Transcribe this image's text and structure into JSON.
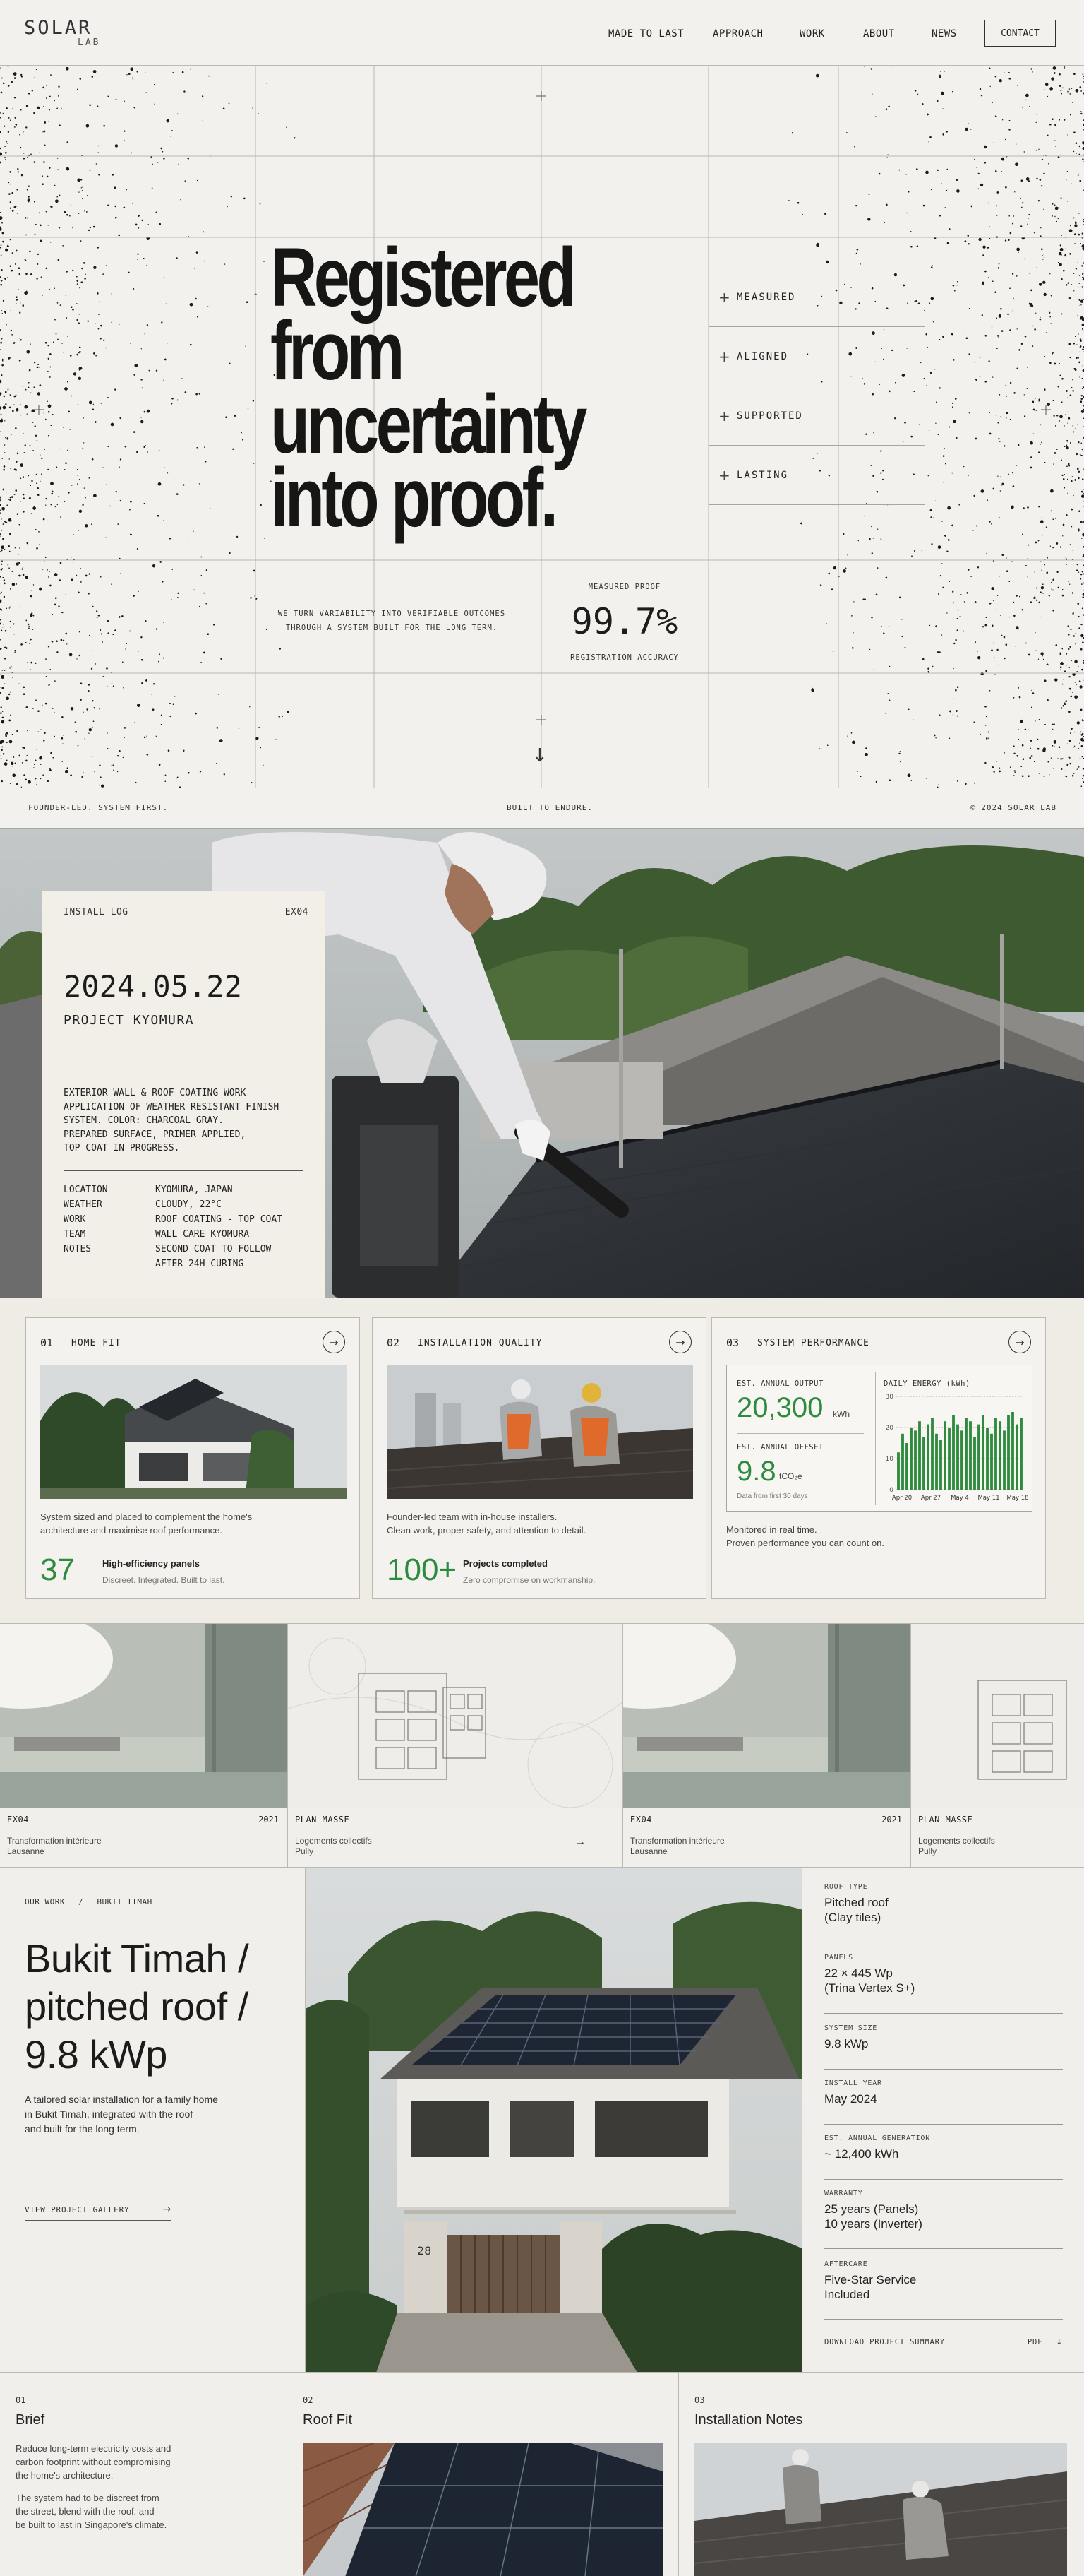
{
  "nav": {
    "logo_main": "SOLAR",
    "logo_sub": "LAB",
    "links": [
      "MADE TO LAST",
      "APPROACH",
      "WORK",
      "ABOUT",
      "NEWS"
    ],
    "contact": "CONTACT"
  },
  "hero": {
    "title_lines": [
      "Registered",
      "from",
      "uncertainty",
      "into proof."
    ],
    "subtitle_lines": [
      "WE TURN VARIABILITY INTO VERIFIABLE OUTCOMES",
      "THROUGH A SYSTEM BUILT FOR THE LONG TERM."
    ],
    "proof_label": "MEASURED PROOF",
    "proof_value": "99.7%",
    "proof_caption": "REGISTRATION ACCURACY",
    "pillars": [
      "MEASURED",
      "ALIGNED",
      "SUPPORTED",
      "LASTING"
    ],
    "scroll_icon": "arrow-down-icon"
  },
  "strip": {
    "left": "FOUNDER-LED. SYSTEM FIRST.",
    "center": "BUILT TO ENDURE.",
    "right": "© 2024 SOLAR LAB"
  },
  "install_log": {
    "label": "INSTALL LOG",
    "code": "EX04",
    "date": "2024.05.22",
    "project": "PROJECT KYOMURA",
    "description_lines": [
      "EXTERIOR WALL & ROOF COATING WORK",
      "APPLICATION OF WEATHER RESISTANT FINISH",
      "SYSTEM. COLOR: CHARCOAL GRAY.",
      "PREPARED SURFACE, PRIMER APPLIED,",
      "TOP COAT IN PROGRESS."
    ],
    "details": [
      {
        "k": "LOCATION",
        "v": [
          "KYOMURA, JAPAN"
        ]
      },
      {
        "k": "WEATHER",
        "v": [
          "CLOUDY, 22°C"
        ]
      },
      {
        "k": "WORK",
        "v": [
          "ROOF COATING - TOP COAT"
        ]
      },
      {
        "k": "TEAM",
        "v": [
          "WALL CARE KYOMURA"
        ]
      },
      {
        "k": "NOTES",
        "v": [
          "SECOND COAT TO FOLLOW",
          "AFTER 24H CURING"
        ]
      }
    ]
  },
  "features": [
    {
      "num": "01",
      "title": "HOME FIT",
      "desc": [
        "System sized and placed to complement the home's",
        "architecture and maximise roof performance."
      ],
      "stat": "37",
      "stat_title": "High-efficiency panels",
      "stat_sub": "Discreet. Integrated. Built to last."
    },
    {
      "num": "02",
      "title": "INSTALLATION QUALITY",
      "desc": [
        "Founder-led team with in-house installers.",
        "Clean work, proper safety, and attention to detail."
      ],
      "stat": "100+",
      "stat_title": "Projects completed",
      "stat_sub": "Zero compromise on workmanship."
    },
    {
      "num": "03",
      "title": "SYSTEM PERFORMANCE",
      "desc": [
        "Monitored in real time.",
        "Proven performance you can count on."
      ]
    }
  ],
  "performance": {
    "output_label": "EST. ANNUAL OUTPUT",
    "output_value": "20,300",
    "output_unit": "kWh",
    "offset_label": "EST. ANNUAL OFFSET",
    "offset_value": "9.8",
    "offset_unit": "tCO₂e",
    "offset_note": "Data from first 30 days",
    "chart_label": "DAILY ENERGY (kWh)"
  },
  "chart_data": {
    "type": "bar",
    "title": "DAILY ENERGY (kWh)",
    "xlabel": "",
    "ylabel": "",
    "ylim": [
      0,
      30
    ],
    "yticks": [
      0,
      10,
      20,
      30
    ],
    "x_ticks": [
      "Apr 20",
      "Apr 27",
      "May 4",
      "May 11",
      "May 18"
    ],
    "grid": true,
    "color": "#2e8b3e",
    "values": [
      12,
      18,
      15,
      20,
      19,
      22,
      17,
      21,
      23,
      18,
      16,
      22,
      20,
      24,
      21,
      19,
      23,
      22,
      17,
      21,
      24,
      20,
      18,
      23,
      22,
      19,
      24,
      25,
      21,
      23
    ]
  },
  "projects": [
    {
      "label": "EX04",
      "year": "2021",
      "line1": "Transformation intérieure",
      "line2": "Lausanne"
    },
    {
      "label": "PLAN MASSE",
      "year": "",
      "line1": "Logements collectifs",
      "line2": "Pully"
    },
    {
      "label": "EX04",
      "year": "2021",
      "line1": "Transformation intérieure",
      "line2": "Lausanne"
    },
    {
      "label": "PLAN MASSE",
      "year": "",
      "line1": "Logements collectifs",
      "line2": "Pully"
    }
  ],
  "case_study": {
    "crumb_1": "OUR WORK",
    "crumb_sep": "/",
    "crumb_2": "BUKIT TIMAH",
    "title_lines": [
      "Bukit Timah /",
      "pitched roof /",
      "9.8 kWp"
    ],
    "desc_lines": [
      "A tailored solar installation for a family home",
      "in Bukit Timah, integrated with the roof",
      "and built for the long term."
    ],
    "gallery_label": "VIEW PROJECT GALLERY",
    "house_number": "28",
    "specs": [
      {
        "k": "ROOF TYPE",
        "v": [
          "Pitched roof",
          "(Clay tiles)"
        ]
      },
      {
        "k": "PANELS",
        "v": [
          "22 × 445 Wp",
          "(Trina Vertex S+)"
        ]
      },
      {
        "k": "SYSTEM SIZE",
        "v": [
          "9.8 kWp"
        ]
      },
      {
        "k": "INSTALL YEAR",
        "v": [
          "May 2024"
        ]
      },
      {
        "k": "EST. ANNUAL GENERATION",
        "v": [
          "~ 12,400 kWh"
        ]
      },
      {
        "k": "WARRANTY",
        "v": [
          "25 years (Panels)",
          "10 years (Inverter)"
        ]
      },
      {
        "k": "AFTERCARE",
        "v": [
          "Five-Star Service",
          "Included"
        ]
      }
    ],
    "download_label": "DOWNLOAD PROJECT SUMMARY",
    "download_format": "PDF"
  },
  "bottom": [
    {
      "num": "01",
      "title": "Brief",
      "p1": [
        "Reduce long-term electricity costs and",
        "carbon footprint without compromising",
        "the home's architecture."
      ],
      "p2": [
        "The system had to be discreet from",
        "the street, blend with the roof, and",
        "be built to last in Singapore's climate."
      ]
    },
    {
      "num": "02",
      "title": "Roof Fit"
    },
    {
      "num": "03",
      "title": "Installation Notes"
    }
  ]
}
